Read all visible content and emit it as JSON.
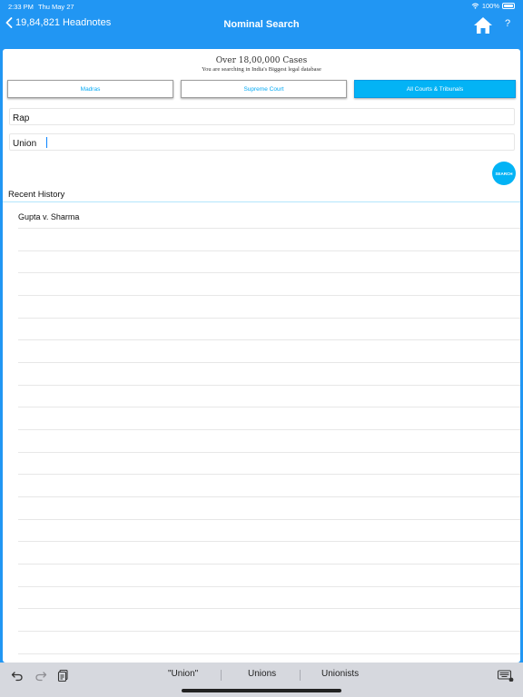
{
  "status_bar": {
    "time": "2:33 PM",
    "date": "Thu May 27",
    "battery": "100%"
  },
  "nav": {
    "back_label": "19,84,821 Headnotes",
    "title": "Nominal Search",
    "help_label": "?"
  },
  "header": {
    "title": "Over 18,00,000 Cases",
    "subtitle": "You are searching in India's Biggest legal database"
  },
  "courts": [
    {
      "label": "Madras",
      "active": false
    },
    {
      "label": "Supreme Court",
      "active": false
    },
    {
      "label": "All Courts & Tribunals",
      "active": true
    }
  ],
  "form": {
    "party1_value": "Rap",
    "party2_value": "Union",
    "search_label": "SEARCH"
  },
  "recent": {
    "title": "Recent History",
    "items": [
      "Gupta v. Sharma"
    ]
  },
  "keyboard": {
    "suggestions": [
      "\"Union\"",
      "Unions",
      "Unionists"
    ]
  },
  "colors": {
    "accent": "#2196f3",
    "button_active": "#03b3f5",
    "button_text": "#03a9f4"
  },
  "icons": [
    "chevron-left-icon",
    "wifi-icon",
    "battery-icon",
    "home-icon",
    "undo-icon",
    "redo-icon",
    "paste-icon",
    "keyboard-icon"
  ]
}
